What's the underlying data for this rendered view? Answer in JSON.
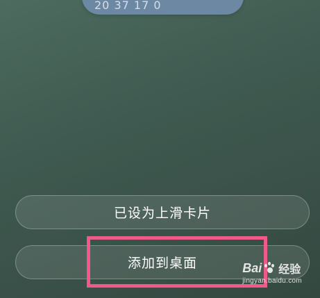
{
  "top_card": {
    "partial_text": "20 37 17 0"
  },
  "buttons": {
    "set_card_label": "已设为上滑卡片",
    "add_to_desktop_label": "添加到桌面"
  },
  "watermark": {
    "brand_prefix": "Bai",
    "brand_suffix": "经验",
    "url": "jingyan.baidu.com"
  },
  "colors": {
    "highlight": "#f05a8a",
    "top_card": "#6c88a3"
  }
}
